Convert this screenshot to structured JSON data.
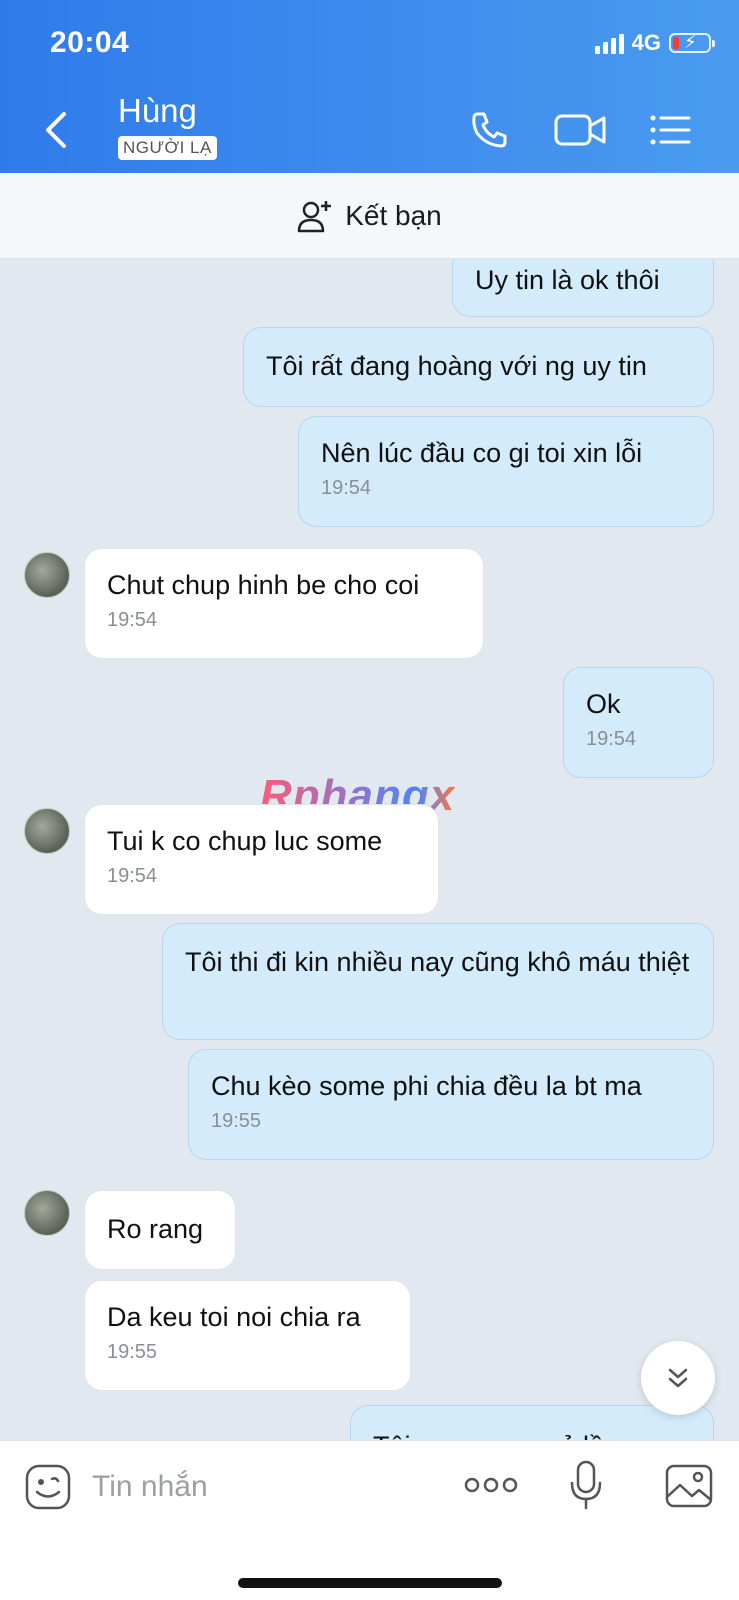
{
  "status": {
    "time": "20:04",
    "network": "4G"
  },
  "header": {
    "name": "Hùng",
    "badge": "NGƯỜI LẠ"
  },
  "add_friend": {
    "label": "Kết bạn"
  },
  "watermark": "Rphangx",
  "messages": [
    {
      "text": "Uy tin là ok thôi"
    },
    {
      "text": "Tôi rất đang hoàng với ng uy tin"
    },
    {
      "text": "Nên lúc đầu co gi toi xin lỗi",
      "time": "19:54"
    },
    {
      "text": "Chut chup hinh be cho coi",
      "time": "19:54"
    },
    {
      "text": "Ok",
      "time": "19:54"
    },
    {
      "text": "Tui k co chup luc some",
      "time": "19:54"
    },
    {
      "text": "Tôi thi đi kin nhiều nay cũng khô máu thiệt"
    },
    {
      "text": "Chu kèo some phi chia đều la bt ma",
      "time": "19:55"
    },
    {
      "text": "Ro rang"
    },
    {
      "text": "Da keu toi noi chia ra",
      "time": "19:55"
    },
    {
      "text": "Tôi ... ... ... ... ...ẻ lầ..."
    }
  ],
  "input": {
    "placeholder": "Tin nhắn"
  },
  "colors": {
    "header_start": "#2f7bea",
    "header_end": "#4a9bf0",
    "my_bubble": "#d4ebfb",
    "their_bubble": "#ffffff",
    "chat_bg": "#e2e8f0"
  }
}
